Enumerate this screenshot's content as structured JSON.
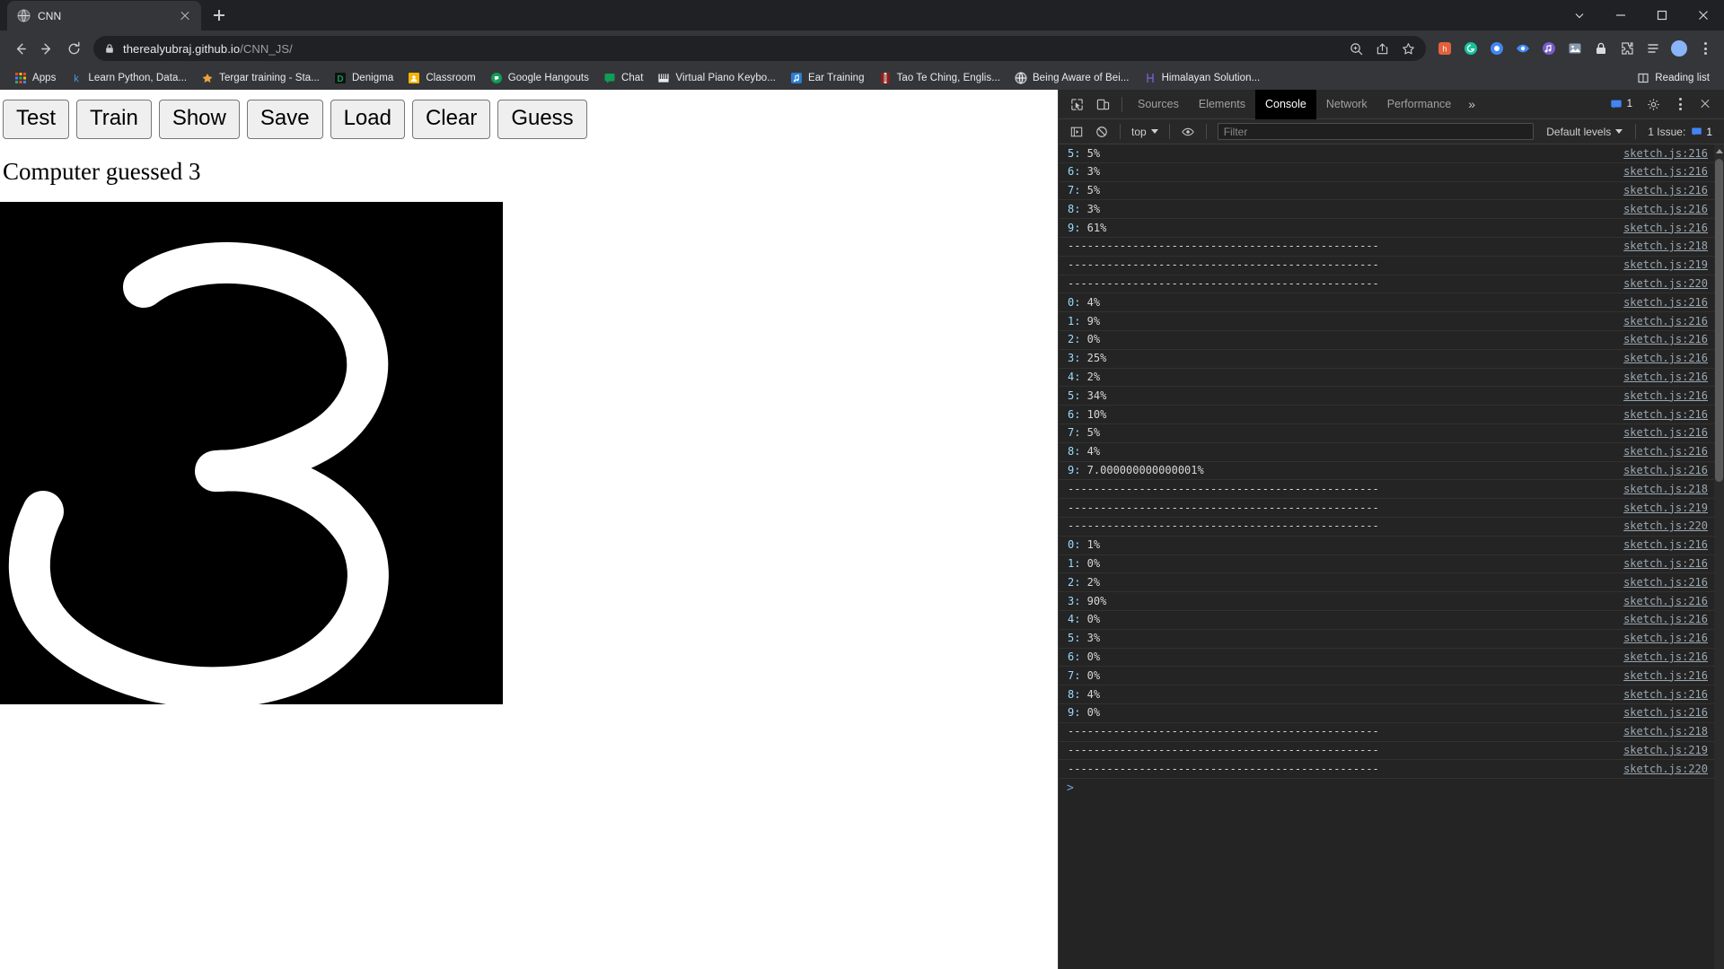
{
  "window": {
    "minimize_icon": "minimize-icon",
    "maximize_icon": "maximize-icon",
    "close_icon": "close-icon",
    "chevron_icon": "chevron-down-icon"
  },
  "tab": {
    "title": "CNN",
    "favicon": "globe-icon",
    "close_label": "close-tab",
    "new_tab_label": "new-tab"
  },
  "nav": {
    "back": "back-icon",
    "forward": "forward-icon",
    "reload": "reload-icon"
  },
  "omnibox": {
    "lock_icon": "lock-icon",
    "url_host": "therealyubraj.github.io",
    "url_path": "/CNN_JS/",
    "zoom_icon": "zoom-in-icon",
    "share_icon": "share-icon",
    "bookmark_icon": "star-icon"
  },
  "extensions": [
    {
      "name": "extension-honey",
      "color": "#e5603c",
      "glyph": "Ũ"
    },
    {
      "name": "extension-grammarly",
      "color": "#15c39a",
      "glyph": "G"
    },
    {
      "name": "extension-generic-blue",
      "color": "#4286f4",
      "glyph": "●"
    },
    {
      "name": "extension-eye",
      "color": "#3f8cff",
      "glyph": "◉"
    },
    {
      "name": "extension-audio",
      "color": "#b06ef0",
      "glyph": "♪"
    },
    {
      "name": "extension-picture",
      "color": "#6d7f93",
      "glyph": "▣"
    },
    {
      "name": "extension-lock",
      "color": "#d7dbe0",
      "glyph": "⊟"
    },
    {
      "name": "extension-puzzle",
      "color": "#c8cbcf",
      "glyph": "❖"
    },
    {
      "name": "extension-list",
      "color": "#c8cbcf",
      "glyph": "≡"
    },
    {
      "name": "extension-profile",
      "color": "#8ab4f8",
      "glyph": "●"
    }
  ],
  "menu_label": "chrome-menu",
  "bookmarks": {
    "apps_label": "Apps",
    "items": [
      {
        "label": "Learn Python, Data...",
        "icon": "k-icon",
        "color": "#4a9ae0"
      },
      {
        "label": "Tergar training - Sta...",
        "icon": "lotus-icon",
        "color": "#e8a33d"
      },
      {
        "label": "Denigma",
        "icon": "d-icon",
        "color": "#0f9d58"
      },
      {
        "label": "Classroom",
        "icon": "classroom-icon",
        "color": "#f4b400"
      },
      {
        "label": "Google Hangouts",
        "icon": "hangouts-icon",
        "color": "#0f9d58"
      },
      {
        "label": "Chat",
        "icon": "chat-icon",
        "color": "#0f9d58"
      },
      {
        "label": "Virtual Piano Keybo...",
        "icon": "piano-icon",
        "color": "#e8eaed"
      },
      {
        "label": "Ear Training",
        "icon": "music-icon",
        "color": "#2a7fd4"
      },
      {
        "label": "Tao Te Ching, Englis...",
        "icon": "book-icon",
        "color": "#c0392b"
      },
      {
        "label": "Being Aware of Bei...",
        "icon": "globe-icon",
        "color": "#e8eaed"
      },
      {
        "label": "Himalayan Solution...",
        "icon": "h-icon",
        "color": "#7a5cc8"
      }
    ],
    "reading_list": "Reading list",
    "reading_list_icon": "reading-list-icon"
  },
  "page": {
    "buttons": [
      "Test",
      "Train",
      "Show",
      "Save",
      "Load",
      "Clear",
      "Guess"
    ],
    "result_text": "Computer guessed 3",
    "canvas": {
      "name": "drawing-canvas",
      "background": "#000000",
      "stroke_color": "#ffffff",
      "digit_drawn": "3"
    }
  },
  "devtools": {
    "inspect_icon": "inspect-element-icon",
    "device_icon": "device-toolbar-icon",
    "tabs": [
      {
        "label": "Sources",
        "active": false
      },
      {
        "label": "Elements",
        "active": false
      },
      {
        "label": "Console",
        "active": true
      },
      {
        "label": "Network",
        "active": false
      },
      {
        "label": "Performance",
        "active": false
      }
    ],
    "more_tabs_icon": "chevron-right-more-icon",
    "messages_icon": "messages-icon",
    "messages_count": "1",
    "settings_icon": "gear-icon",
    "kebab_icon": "more-options-icon",
    "close_icon": "close-devtools-icon",
    "toolbar": {
      "sidebar_icon": "console-sidebar-icon",
      "clear_icon": "clear-console-icon",
      "context": "top",
      "context_caret": "chevron-down-icon",
      "eye_icon": "live-expression-icon",
      "filter_placeholder": "Filter",
      "filter_value": "",
      "levels_label": "Default levels",
      "levels_caret": "chevron-down-icon",
      "issues_label": "1 Issue:",
      "issues_count": "1",
      "issues_icon": "issue-badge-icon"
    },
    "console_rows": [
      {
        "text": "5: 5%",
        "source": "sketch.js:216",
        "type": "entry"
      },
      {
        "text": "6: 3%",
        "source": "sketch.js:216",
        "type": "entry"
      },
      {
        "text": "7: 5%",
        "source": "sketch.js:216",
        "type": "entry"
      },
      {
        "text": "8: 3%",
        "source": "sketch.js:216",
        "type": "entry"
      },
      {
        "text": "9: 61%",
        "source": "sketch.js:216",
        "type": "entry"
      },
      {
        "text": "------------------------------------------------",
        "source": "sketch.js:218",
        "type": "sep"
      },
      {
        "text": "------------------------------------------------",
        "source": "sketch.js:219",
        "type": "sep"
      },
      {
        "text": "------------------------------------------------",
        "source": "sketch.js:220",
        "type": "sep"
      },
      {
        "text": "0: 4%",
        "source": "sketch.js:216",
        "type": "entry"
      },
      {
        "text": "1: 9%",
        "source": "sketch.js:216",
        "type": "entry"
      },
      {
        "text": "2: 0%",
        "source": "sketch.js:216",
        "type": "entry"
      },
      {
        "text": "3: 25%",
        "source": "sketch.js:216",
        "type": "entry"
      },
      {
        "text": "4: 2%",
        "source": "sketch.js:216",
        "type": "entry"
      },
      {
        "text": "5: 34%",
        "source": "sketch.js:216",
        "type": "entry"
      },
      {
        "text": "6: 10%",
        "source": "sketch.js:216",
        "type": "entry"
      },
      {
        "text": "7: 5%",
        "source": "sketch.js:216",
        "type": "entry"
      },
      {
        "text": "8: 4%",
        "source": "sketch.js:216",
        "type": "entry"
      },
      {
        "text": "9: 7.000000000000001%",
        "source": "sketch.js:216",
        "type": "entry"
      },
      {
        "text": "------------------------------------------------",
        "source": "sketch.js:218",
        "type": "sep"
      },
      {
        "text": "------------------------------------------------",
        "source": "sketch.js:219",
        "type": "sep"
      },
      {
        "text": "------------------------------------------------",
        "source": "sketch.js:220",
        "type": "sep"
      },
      {
        "text": "0: 1%",
        "source": "sketch.js:216",
        "type": "entry"
      },
      {
        "text": "1: 0%",
        "source": "sketch.js:216",
        "type": "entry"
      },
      {
        "text": "2: 2%",
        "source": "sketch.js:216",
        "type": "entry"
      },
      {
        "text": "3: 90%",
        "source": "sketch.js:216",
        "type": "entry"
      },
      {
        "text": "4: 0%",
        "source": "sketch.js:216",
        "type": "entry"
      },
      {
        "text": "5: 3%",
        "source": "sketch.js:216",
        "type": "entry"
      },
      {
        "text": "6: 0%",
        "source": "sketch.js:216",
        "type": "entry"
      },
      {
        "text": "7: 0%",
        "source": "sketch.js:216",
        "type": "entry"
      },
      {
        "text": "8: 4%",
        "source": "sketch.js:216",
        "type": "entry"
      },
      {
        "text": "9: 0%",
        "source": "sketch.js:216",
        "type": "entry"
      },
      {
        "text": "------------------------------------------------",
        "source": "sketch.js:218",
        "type": "sep"
      },
      {
        "text": "------------------------------------------------",
        "source": "sketch.js:219",
        "type": "sep"
      },
      {
        "text": "------------------------------------------------",
        "source": "sketch.js:220",
        "type": "sep"
      }
    ],
    "prompt": ">"
  }
}
